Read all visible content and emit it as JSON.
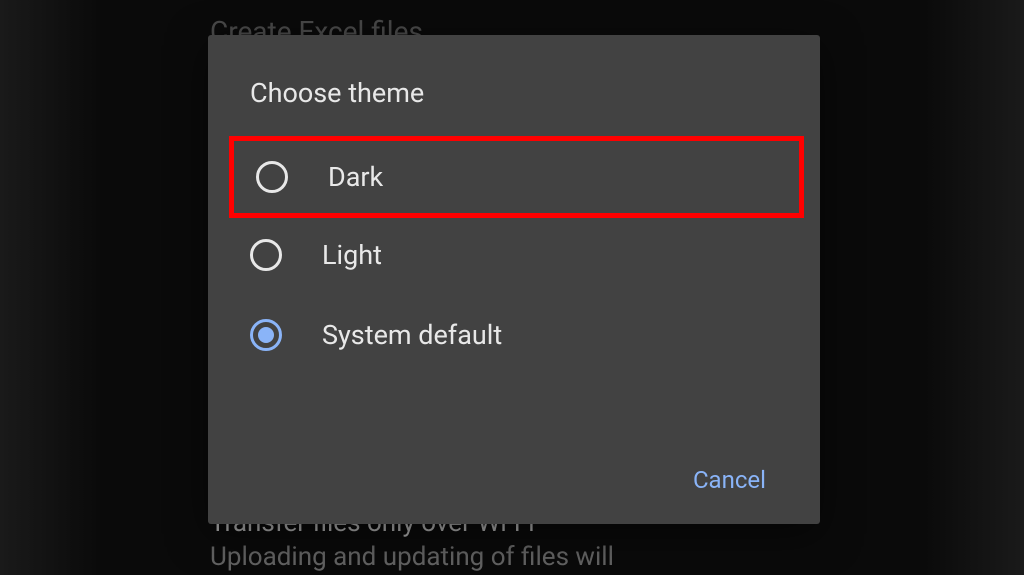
{
  "background": {
    "topText": "Create Excel files",
    "bottomLine1": "Transfer files only over Wi-Fi",
    "bottomLine2": "Uploading and updating of files will"
  },
  "dialog": {
    "title": "Choose theme",
    "options": [
      {
        "label": "Dark",
        "selected": false,
        "highlighted": true
      },
      {
        "label": "Light",
        "selected": false,
        "highlighted": false
      },
      {
        "label": "System default",
        "selected": true,
        "highlighted": false
      }
    ],
    "cancelLabel": "Cancel"
  },
  "colors": {
    "accent": "#8ab4f8",
    "dialogBg": "#424242",
    "highlight": "#ff0000"
  }
}
